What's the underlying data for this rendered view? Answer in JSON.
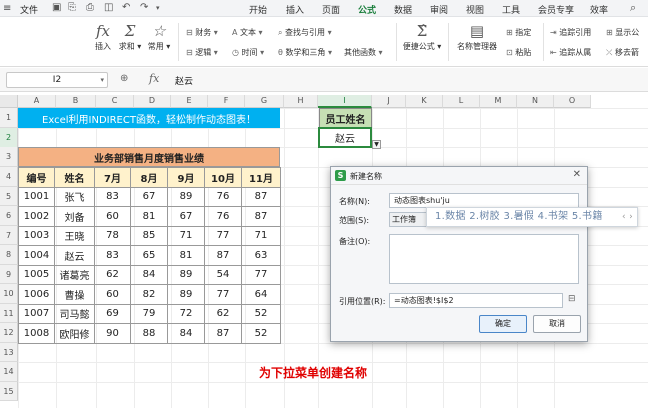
{
  "menubar": {
    "file_label": "文件",
    "tabs": [
      "开始",
      "插入",
      "页面",
      "公式",
      "数据",
      "审阅",
      "视图",
      "工具",
      "会员专享",
      "效率"
    ],
    "active_tab": "公式"
  },
  "ribbon": {
    "insert_label": "插入",
    "sum_label": "求和",
    "common_label": "常用",
    "finance_label": "财务",
    "logic_label": "逻辑",
    "text_label": "文本",
    "time_label": "时间",
    "lookup_label": "查找与引用",
    "math_label": "数学和三角",
    "other_label": "其他函数",
    "formula_label": "便捷公式",
    "name_mgr_label": "名称管理器",
    "define_label": "指定",
    "paste_label": "粘贴",
    "trace_prec_label": "追踪引用",
    "trace_dep_label": "追踪从属",
    "show_label": "显示公",
    "remove_label": "移去箭"
  },
  "formula_bar": {
    "cell_ref": "I2",
    "fx": "fx",
    "value": "赵云"
  },
  "columns": [
    "A",
    "B",
    "C",
    "D",
    "E",
    "F",
    "G",
    "H",
    "I",
    "J",
    "K",
    "L",
    "M",
    "N",
    "O"
  ],
  "rows": [
    "1",
    "2",
    "3",
    "4",
    "5",
    "6",
    "7",
    "8",
    "9",
    "10",
    "11",
    "12",
    "13",
    "14",
    "15"
  ],
  "sheet": {
    "banner": "Excel利用INDIRECT函数，轻松制作动态图表！",
    "table_title": "业务部销售月度销售业绩",
    "headers": [
      "编号",
      "姓名",
      "7月",
      "8月",
      "9月",
      "10月",
      "11月"
    ],
    "data": [
      [
        "1001",
        "张飞",
        "83",
        "67",
        "89",
        "76",
        "87"
      ],
      [
        "1002",
        "刘备",
        "60",
        "81",
        "67",
        "76",
        "87"
      ],
      [
        "1003",
        "王晓",
        "78",
        "85",
        "71",
        "77",
        "71"
      ],
      [
        "1004",
        "赵云",
        "83",
        "65",
        "81",
        "87",
        "63"
      ],
      [
        "1005",
        "诸葛亮",
        "62",
        "84",
        "89",
        "54",
        "77"
      ],
      [
        "1006",
        "曹操",
        "60",
        "82",
        "89",
        "77",
        "64"
      ],
      [
        "1007",
        "司马懿",
        "69",
        "79",
        "72",
        "62",
        "52"
      ],
      [
        "1008",
        "欧阳修",
        "90",
        "88",
        "84",
        "87",
        "52"
      ]
    ],
    "emp_header": "员工姓名",
    "emp_value": "赵云"
  },
  "dialog": {
    "title": "新建名称",
    "name_label": "名称(N):",
    "name_value": "动态图表shu'ju",
    "scope_label": "范围(S):",
    "scope_value": "工作簿",
    "comment_label": "备注(O):",
    "ref_label": "引用位置(R):",
    "ref_value": "=动态图表!$I$2",
    "ok_label": "确定",
    "cancel_label": "取消"
  },
  "ime": {
    "candidates": "1.数据  2.树胶  3.暑假  4.书架  5.书籍",
    "arrows": "‹ ›"
  },
  "caption": "为下拉菜单创建名称"
}
